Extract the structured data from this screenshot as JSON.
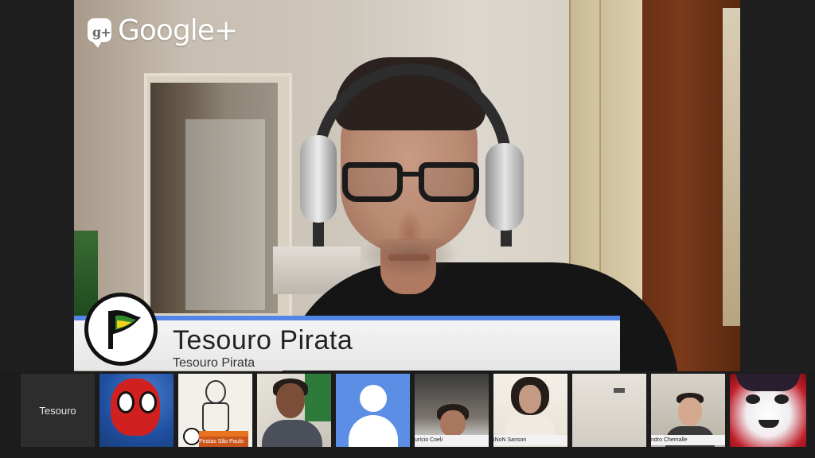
{
  "brand": {
    "icon_letters": "g+",
    "name": "Google+"
  },
  "lower_third": {
    "title": "Tesouro Pirata",
    "subtitle": "Tesouro Pirata",
    "accent_color": "#5286e6"
  },
  "filmstrip": {
    "participants": [
      {
        "label": "Tesouro"
      },
      {
        "label": ""
      },
      {
        "label": "Piratas São Paulo"
      },
      {
        "label": ""
      },
      {
        "label": ""
      },
      {
        "label": "urício Coeli"
      },
      {
        "label": "iNoN Sanson"
      },
      {
        "label": ""
      },
      {
        "label": "ndro Chemalle"
      },
      {
        "label": ""
      }
    ]
  }
}
